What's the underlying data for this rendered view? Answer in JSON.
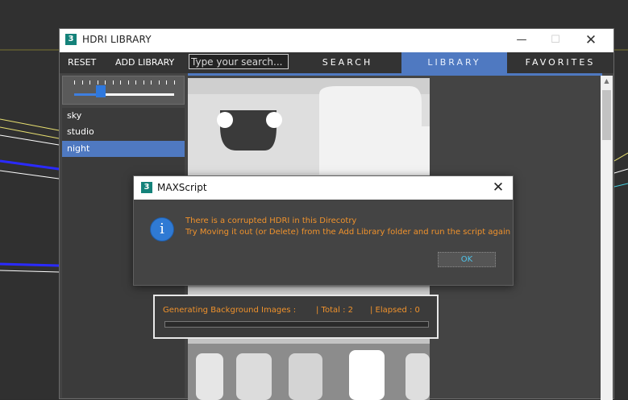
{
  "hdri_window": {
    "title": "HDRI LIBRARY",
    "app_icon_glyph": "3",
    "controls": {
      "minimize": "—",
      "maximize": "☐",
      "close": "✕"
    },
    "toolbar": {
      "reset_label": "RESET",
      "add_library_label": "ADD LIBRARY",
      "search_placeholder": "Type your search...",
      "tabs": [
        {
          "label": "SEARCH",
          "active": false
        },
        {
          "label": "LIBRARY",
          "active": true
        },
        {
          "label": "FAVORITES",
          "active": false
        }
      ]
    },
    "thumbnail_size_slider": {
      "value_fraction": 0.27,
      "ticks": 14
    },
    "categories": [
      {
        "label": "sky",
        "selected": false
      },
      {
        "label": "studio",
        "selected": false
      },
      {
        "label": "night",
        "selected": true
      }
    ],
    "accent_color": "#4f79c1"
  },
  "maxscript_dialog": {
    "title": "MAXScript",
    "icon": "info-icon",
    "message_line1": "There is a corrupted HDRI in this Direcotry",
    "message_line2": "Try Moving it out (or Delete) from the Add Library folder and run the script again",
    "ok_label": "OK",
    "message_color": "#f0922c"
  },
  "progress_panel": {
    "label": "Generating Background Images :",
    "total": "| Total : 2",
    "elapsed": "| Elapsed : 0",
    "progress_fraction": 0
  }
}
